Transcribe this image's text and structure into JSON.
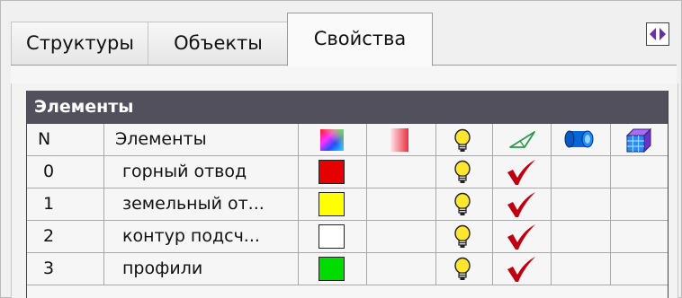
{
  "tabs": [
    {
      "label": "Структуры",
      "active": false
    },
    {
      "label": "Объекты",
      "active": false
    },
    {
      "label": "Свойства",
      "active": true
    }
  ],
  "panel_toggle_icon": "collapse-expand-arrows-icon",
  "elements_panel": {
    "title": "Элементы",
    "columns": [
      {
        "label": "N"
      },
      {
        "label": "Элементы"
      },
      {
        "icon": "color-palette-icon"
      },
      {
        "icon": "gradient-icon"
      },
      {
        "icon": "lightbulb-icon"
      },
      {
        "icon": "pyramid-outline-icon"
      },
      {
        "icon": "cylinder-icon"
      },
      {
        "icon": "cube-icon"
      }
    ],
    "rows": [
      {
        "n": "0",
        "name": "горный отвод",
        "color": "#e60000",
        "visible": true,
        "checked": true
      },
      {
        "n": "1",
        "name": "земельный от...",
        "color": "#ffff00",
        "visible": true,
        "checked": true
      },
      {
        "n": "2",
        "name": "контур подсч...",
        "color": "#ffffff",
        "visible": true,
        "checked": true
      },
      {
        "n": "3",
        "name": "профили",
        "color": "#00dc00",
        "visible": true,
        "checked": true
      }
    ]
  },
  "colors": {
    "header_bg": "#52505d",
    "check_red": "#c00010",
    "bulb_yellow": "#ffe62e"
  }
}
